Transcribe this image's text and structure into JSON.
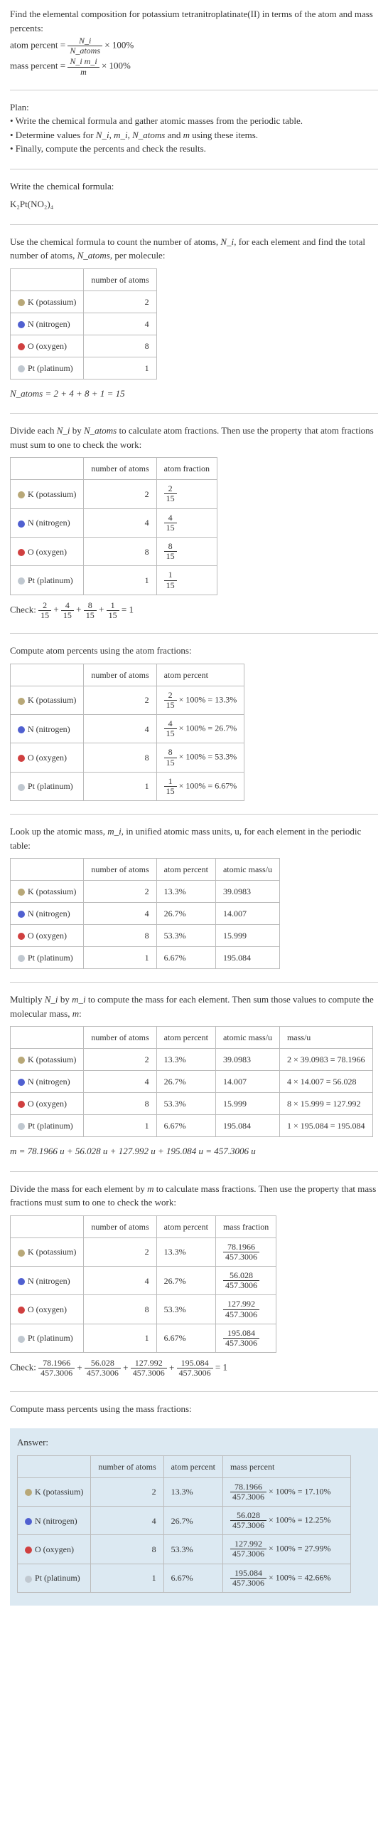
{
  "intro": {
    "prompt": "Find the elemental composition for potassium tetranitroplatinate(II) in terms of the atom and mass percents:",
    "atom_label": "atom percent =",
    "atom_frac_num": "N_i",
    "atom_frac_den": "N_atoms",
    "times100a": "× 100%",
    "mass_label": "mass percent =",
    "mass_frac_num": "N_i m_i",
    "mass_frac_den": "m",
    "times100b": "× 100%"
  },
  "plan": {
    "header": "Plan:",
    "line1": "• Write the chemical formula and gather atomic masses from the periodic table.",
    "line2_a": "• Determine values for ",
    "line2_vars": "N_i, m_i, N_atoms",
    "line2_b": " and ",
    "line2_m": "m",
    "line2_c": " using these items.",
    "line3": "• Finally, compute the percents and check the results."
  },
  "formula": {
    "header": "Write the chemical formula:",
    "value": "K₂Pt(NO₂)₄"
  },
  "count": {
    "intro_a": "Use the chemical formula to count the number of atoms, ",
    "intro_ni": "N_i",
    "intro_b": ", for each element and find the total number of atoms, ",
    "intro_na": "N_atoms",
    "intro_c": ", per molecule:",
    "col_atoms": "number of atoms",
    "rows": [
      {
        "sw": "sw-k",
        "el": "K (potassium)",
        "n": "2"
      },
      {
        "sw": "sw-n",
        "el": "N (nitrogen)",
        "n": "4"
      },
      {
        "sw": "sw-o",
        "el": "O (oxygen)",
        "n": "8"
      },
      {
        "sw": "sw-pt",
        "el": "Pt (platinum)",
        "n": "1"
      }
    ],
    "total": "N_atoms = 2 + 4 + 8 + 1 = 15"
  },
  "atomfrac": {
    "intro_a": "Divide each ",
    "intro_ni": "N_i",
    "intro_b": " by ",
    "intro_na": "N_atoms",
    "intro_c": " to calculate atom fractions. Then use the property that atom fractions must sum to one to check the work:",
    "col_atoms": "number of atoms",
    "col_frac": "atom fraction",
    "rows": [
      {
        "sw": "sw-k",
        "el": "K (potassium)",
        "n": "2",
        "fnum": "2",
        "fden": "15"
      },
      {
        "sw": "sw-n",
        "el": "N (nitrogen)",
        "n": "4",
        "fnum": "4",
        "fden": "15"
      },
      {
        "sw": "sw-o",
        "el": "O (oxygen)",
        "n": "8",
        "fnum": "8",
        "fden": "15"
      },
      {
        "sw": "sw-pt",
        "el": "Pt (platinum)",
        "n": "1",
        "fnum": "1",
        "fden": "15"
      }
    ],
    "check_label": "Check: ",
    "check_expr": " = 1"
  },
  "atompct": {
    "intro": "Compute atom percents using the atom fractions:",
    "col_atoms": "number of atoms",
    "col_pct": "atom percent",
    "rows": [
      {
        "sw": "sw-k",
        "el": "K (potassium)",
        "n": "2",
        "fnum": "2",
        "fden": "15",
        "res": "× 100% = 13.3%"
      },
      {
        "sw": "sw-n",
        "el": "N (nitrogen)",
        "n": "4",
        "fnum": "4",
        "fden": "15",
        "res": "× 100% = 26.7%"
      },
      {
        "sw": "sw-o",
        "el": "O (oxygen)",
        "n": "8",
        "fnum": "8",
        "fden": "15",
        "res": "× 100% = 53.3%"
      },
      {
        "sw": "sw-pt",
        "el": "Pt (platinum)",
        "n": "1",
        "fnum": "1",
        "fden": "15",
        "res": "× 100% = 6.67%"
      }
    ]
  },
  "atomicmass": {
    "intro_a": "Look up the atomic mass, ",
    "intro_mi": "m_i",
    "intro_b": ", in unified atomic mass units, u, for each element in the periodic table:",
    "col_atoms": "number of atoms",
    "col_pct": "atom percent",
    "col_mass": "atomic mass/u",
    "rows": [
      {
        "sw": "sw-k",
        "el": "K (potassium)",
        "n": "2",
        "pct": "13.3%",
        "mass": "39.0983"
      },
      {
        "sw": "sw-n",
        "el": "N (nitrogen)",
        "n": "4",
        "pct": "26.7%",
        "mass": "14.007"
      },
      {
        "sw": "sw-o",
        "el": "O (oxygen)",
        "n": "8",
        "pct": "53.3%",
        "mass": "15.999"
      },
      {
        "sw": "sw-pt",
        "el": "Pt (platinum)",
        "n": "1",
        "pct": "6.67%",
        "mass": "195.084"
      }
    ]
  },
  "molmass": {
    "intro_a": "Multiply ",
    "intro_ni": "N_i",
    "intro_b": " by ",
    "intro_mi": "m_i",
    "intro_c": " to compute the mass for each element. Then sum those values to compute the molecular mass, ",
    "intro_m": "m",
    "intro_d": ":",
    "col_atoms": "number of atoms",
    "col_pct": "atom percent",
    "col_mass": "atomic mass/u",
    "col_mu": "mass/u",
    "rows": [
      {
        "sw": "sw-k",
        "el": "K (potassium)",
        "n": "2",
        "pct": "13.3%",
        "mass": "39.0983",
        "mu": "2 × 39.0983 = 78.1966"
      },
      {
        "sw": "sw-n",
        "el": "N (nitrogen)",
        "n": "4",
        "pct": "26.7%",
        "mass": "14.007",
        "mu": "4 × 14.007 = 56.028"
      },
      {
        "sw": "sw-o",
        "el": "O (oxygen)",
        "n": "8",
        "pct": "53.3%",
        "mass": "15.999",
        "mu": "8 × 15.999 = 127.992"
      },
      {
        "sw": "sw-pt",
        "el": "Pt (platinum)",
        "n": "1",
        "pct": "6.67%",
        "mass": "195.084",
        "mu": "1 × 195.084 = 195.084"
      }
    ],
    "total": "m = 78.1966 u + 56.028 u + 127.992 u + 195.084 u = 457.3006 u"
  },
  "massfrac": {
    "intro_a": "Divide the mass for each element by ",
    "intro_m": "m",
    "intro_b": " to calculate mass fractions. Then use the property that mass fractions must sum to one to check the work:",
    "col_atoms": "number of atoms",
    "col_pct": "atom percent",
    "col_frac": "mass fraction",
    "rows": [
      {
        "sw": "sw-k",
        "el": "K (potassium)",
        "n": "2",
        "pct": "13.3%",
        "fnum": "78.1966",
        "fden": "457.3006"
      },
      {
        "sw": "sw-n",
        "el": "N (nitrogen)",
        "n": "4",
        "pct": "26.7%",
        "fnum": "56.028",
        "fden": "457.3006"
      },
      {
        "sw": "sw-o",
        "el": "O (oxygen)",
        "n": "8",
        "pct": "53.3%",
        "fnum": "127.992",
        "fden": "457.3006"
      },
      {
        "sw": "sw-pt",
        "el": "Pt (platinum)",
        "n": "1",
        "pct": "6.67%",
        "fnum": "195.084",
        "fden": "457.3006"
      }
    ],
    "check_label": "Check: ",
    "check_expr": " = 1"
  },
  "masspct": {
    "intro": "Compute mass percents using the mass fractions:"
  },
  "answer": {
    "header": "Answer:",
    "col_atoms": "number of atoms",
    "col_pct": "atom percent",
    "col_mpct": "mass percent",
    "rows": [
      {
        "sw": "sw-k",
        "el": "K (potassium)",
        "n": "2",
        "pct": "13.3%",
        "fnum": "78.1966",
        "fden": "457.3006",
        "res": "100% = 17.10%"
      },
      {
        "sw": "sw-n",
        "el": "N (nitrogen)",
        "n": "4",
        "pct": "26.7%",
        "fnum": "56.028",
        "fden": "457.3006",
        "res": "100% = 12.25%"
      },
      {
        "sw": "sw-o",
        "el": "O (oxygen)",
        "n": "8",
        "pct": "53.3%",
        "fnum": "127.992",
        "fden": "457.3006",
        "res": "100% = 27.99%"
      },
      {
        "sw": "sw-pt",
        "el": "Pt (platinum)",
        "n": "1",
        "pct": "6.67%",
        "fnum": "195.084",
        "fden": "457.3006",
        "res": "100% = 42.66%"
      }
    ]
  },
  "chart_data": {
    "type": "table",
    "title": "Elemental composition of potassium tetranitroplatinate(II) K2Pt(NO2)4",
    "elements": [
      "K",
      "N",
      "O",
      "Pt"
    ],
    "number_of_atoms": [
      2,
      4,
      8,
      1
    ],
    "N_atoms_total": 15,
    "atom_fraction": [
      0.1333,
      0.2667,
      0.5333,
      0.0667
    ],
    "atom_percent": [
      13.3,
      26.7,
      53.3,
      6.67
    ],
    "atomic_mass_u": [
      39.0983,
      14.007,
      15.999,
      195.084
    ],
    "element_mass_u": [
      78.1966,
      56.028,
      127.992,
      195.084
    ],
    "molecular_mass_u": 457.3006,
    "mass_fraction": [
      0.171,
      0.1225,
      0.2799,
      0.4266
    ],
    "mass_percent": [
      17.1,
      12.25,
      27.99,
      42.66
    ]
  }
}
